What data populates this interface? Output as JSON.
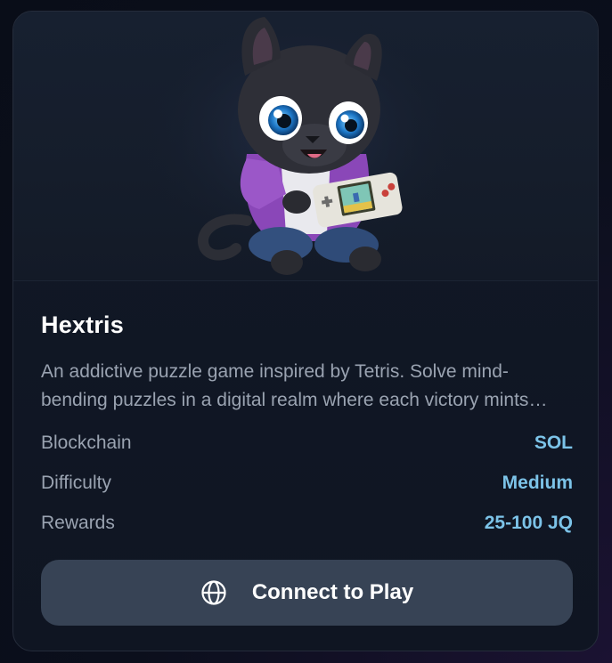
{
  "game": {
    "title": "Hextris",
    "description": "An addictive puzzle game inspired by Tetris. Solve mind-bending puzzles in a digital realm where each victory mints rewards.",
    "image_icon": "panther-gamer-illustration"
  },
  "details": [
    {
      "label": "Blockchain",
      "value": "SOL"
    },
    {
      "label": "Difficulty",
      "value": "Medium"
    },
    {
      "label": "Rewards",
      "value": "25-100 JQ"
    }
  ],
  "cta": {
    "label": "Connect to Play",
    "icon": "globe-icon"
  },
  "colors": {
    "accent_value": "#7cc3e8",
    "button_bg": "#374355",
    "card_bg": "#121927"
  }
}
